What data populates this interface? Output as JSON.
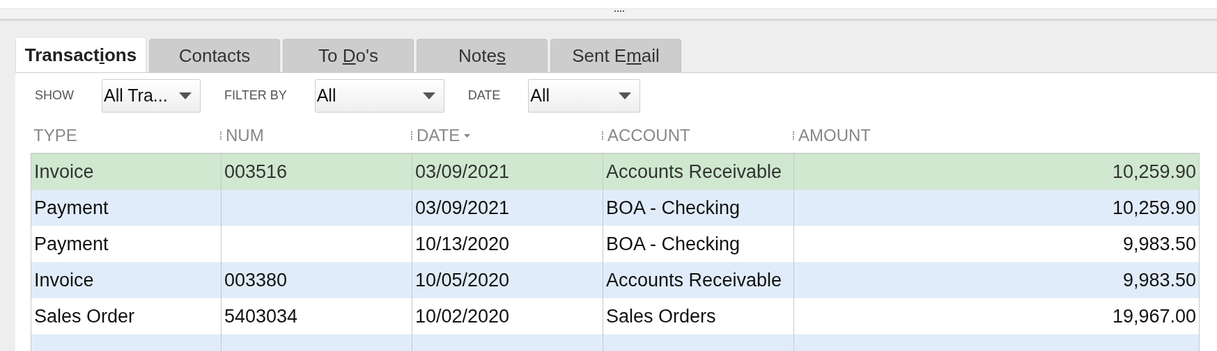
{
  "tabs": [
    {
      "label_parts": [
        "Transact",
        "i",
        "ons"
      ],
      "selected": true
    },
    {
      "label_parts": [
        "Contacts"
      ],
      "selected": false
    },
    {
      "label_parts": [
        "To ",
        "D",
        "o's"
      ],
      "selected": false
    },
    {
      "label_parts": [
        "Note",
        "s"
      ],
      "selected": false
    },
    {
      "label_parts": [
        "Sent E",
        "m",
        "ail"
      ],
      "selected": false
    }
  ],
  "filters": [
    {
      "label": "SHOW",
      "value": "All Tra..."
    },
    {
      "label": "FILTER BY",
      "value": "All"
    },
    {
      "label": "DATE",
      "value": "All"
    }
  ],
  "table": {
    "columns": [
      {
        "label": "TYPE",
        "sorted": false
      },
      {
        "label": "NUM",
        "sorted": false
      },
      {
        "label": "DATE",
        "sorted": true
      },
      {
        "label": "ACCOUNT",
        "sorted": false
      },
      {
        "label": "AMOUNT",
        "sorted": false
      }
    ],
    "rows": [
      {
        "type": "Invoice",
        "num": "003516",
        "date": "03/09/2021",
        "account": "Accounts Receivable",
        "amount": "10,259.90",
        "selected": true
      },
      {
        "type": "Payment",
        "num": "",
        "date": "03/09/2021",
        "account": "BOA - Checking",
        "amount": "10,259.90",
        "selected": false
      },
      {
        "type": "Payment",
        "num": "",
        "date": "10/13/2020",
        "account": "BOA - Checking",
        "amount": "9,983.50",
        "selected": false
      },
      {
        "type": "Invoice",
        "num": "003380",
        "date": "10/05/2020",
        "account": "Accounts Receivable",
        "amount": "9,983.50",
        "selected": false
      },
      {
        "type": "Sales Order",
        "num": "5403034",
        "date": "10/02/2020",
        "account": "Sales Orders",
        "amount": "19,967.00",
        "selected": false
      }
    ]
  }
}
